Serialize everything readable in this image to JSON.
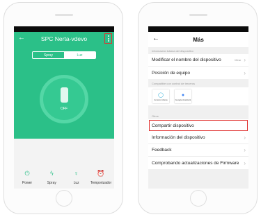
{
  "left_screen": {
    "header": {
      "title": "SPC Nerta-vdevo"
    },
    "toggle": {
      "spray": "Spray",
      "light": "Luz"
    },
    "device": {
      "state": "OFF"
    },
    "controls": [
      {
        "label": "Power",
        "icon": "power-icon"
      },
      {
        "label": "Spray",
        "icon": "spray-icon"
      },
      {
        "label": "Luz",
        "icon": "bulb-icon"
      },
      {
        "label": "Temporizador",
        "icon": "alarm-icon"
      }
    ]
  },
  "right_screen": {
    "header": {
      "title": "Más"
    },
    "section_basic": "Información básica del dispositivo",
    "modify_name": {
      "label": "Modificar el nombre del dispositivo",
      "value": "Mirar"
    },
    "position": {
      "label": "Posición de equipo"
    },
    "section_assistants": "Compatible con control de terceros",
    "assistants": [
      {
        "name": "Amazon Alexa",
        "icon": "alexa-icon"
      },
      {
        "name": "Google Assistant",
        "icon": "google-assistant-icon"
      }
    ],
    "section_others": "Otros",
    "share": {
      "label": "Compartir dispositivo"
    },
    "device_info": {
      "label": "Información del dispositivo"
    },
    "feedback": {
      "label": "Feedback"
    },
    "firmware": {
      "label": "Comprobando actualizaciones de Firmware"
    }
  },
  "colors": {
    "accent": "#2bc088",
    "highlight": "#e0312f"
  }
}
